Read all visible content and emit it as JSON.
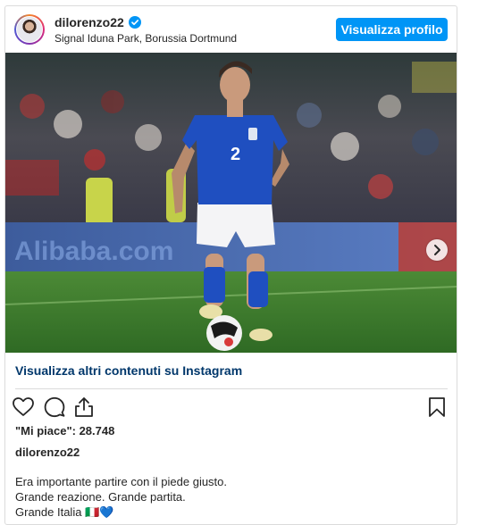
{
  "post": {
    "username": "dilorenzo22",
    "location": "Signal Iduna Park, Borussia Dortmund",
    "profile_button": "Visualizza profilo",
    "more_content_link": "Visualizza altri contenuti su Instagram",
    "likes_text": "\"Mi piace\": 28.748",
    "caption_user": "dilorenzo22",
    "caption_lines": [
      "Era importante partire con il piede giusto.",
      "Grande reazione. Grande partita.",
      "Grande Italia 🇮🇹💙"
    ],
    "photo": {
      "jersey_number": "2",
      "ad_board_text": "Alibaba.com",
      "colors": {
        "jersey": "#1f4fc0",
        "pitch": "#3f7a2e",
        "shorts": "#f4f4f6"
      }
    }
  },
  "icons": [
    "verified-badge-icon",
    "heart-icon",
    "comment-icon",
    "share-icon",
    "bookmark-icon",
    "chevron-right-icon"
  ],
  "theme": {
    "accent": "#0095f6",
    "link": "#00376b",
    "border": "#dbdbdb"
  }
}
